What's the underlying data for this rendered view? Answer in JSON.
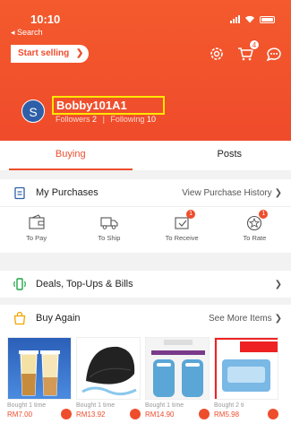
{
  "status": {
    "time": "10:10",
    "back": "◂ Search"
  },
  "header": {
    "start_selling": "Start selling",
    "cart_count": "4",
    "avatar_letter": "S",
    "username": "Bobby101A1",
    "followers_label": "Followers",
    "followers_count": "2",
    "following_label": "Following",
    "following_count": "10"
  },
  "tabs": [
    {
      "label": "Buying"
    },
    {
      "label": "Posts"
    }
  ],
  "purchases": {
    "title": "My Purchases",
    "link": "View Purchase History",
    "orders": [
      {
        "label": "To Pay",
        "icon": "wallet-icon",
        "badge": ""
      },
      {
        "label": "To Ship",
        "icon": "truck-icon",
        "badge": ""
      },
      {
        "label": "To Receive",
        "icon": "package-icon",
        "badge": "1"
      },
      {
        "label": "To Rate",
        "icon": "star-icon",
        "badge": "1"
      }
    ]
  },
  "deals": {
    "title": "Deals, Top-Ups & Bills"
  },
  "buy_again": {
    "title": "Buy Again",
    "link": "See More Items",
    "products": [
      {
        "bought": "Bought 1 time",
        "price": "RM7.00"
      },
      {
        "bought": "Bought 1 time",
        "price": "RM13.92"
      },
      {
        "bought": "Bought 1 time",
        "price": "RM14.90"
      },
      {
        "bought": "Bought 2 ti",
        "price": "RM5.98"
      }
    ]
  },
  "colors": {
    "brand": "#ee4d2d",
    "highlight": "#ffe600"
  }
}
